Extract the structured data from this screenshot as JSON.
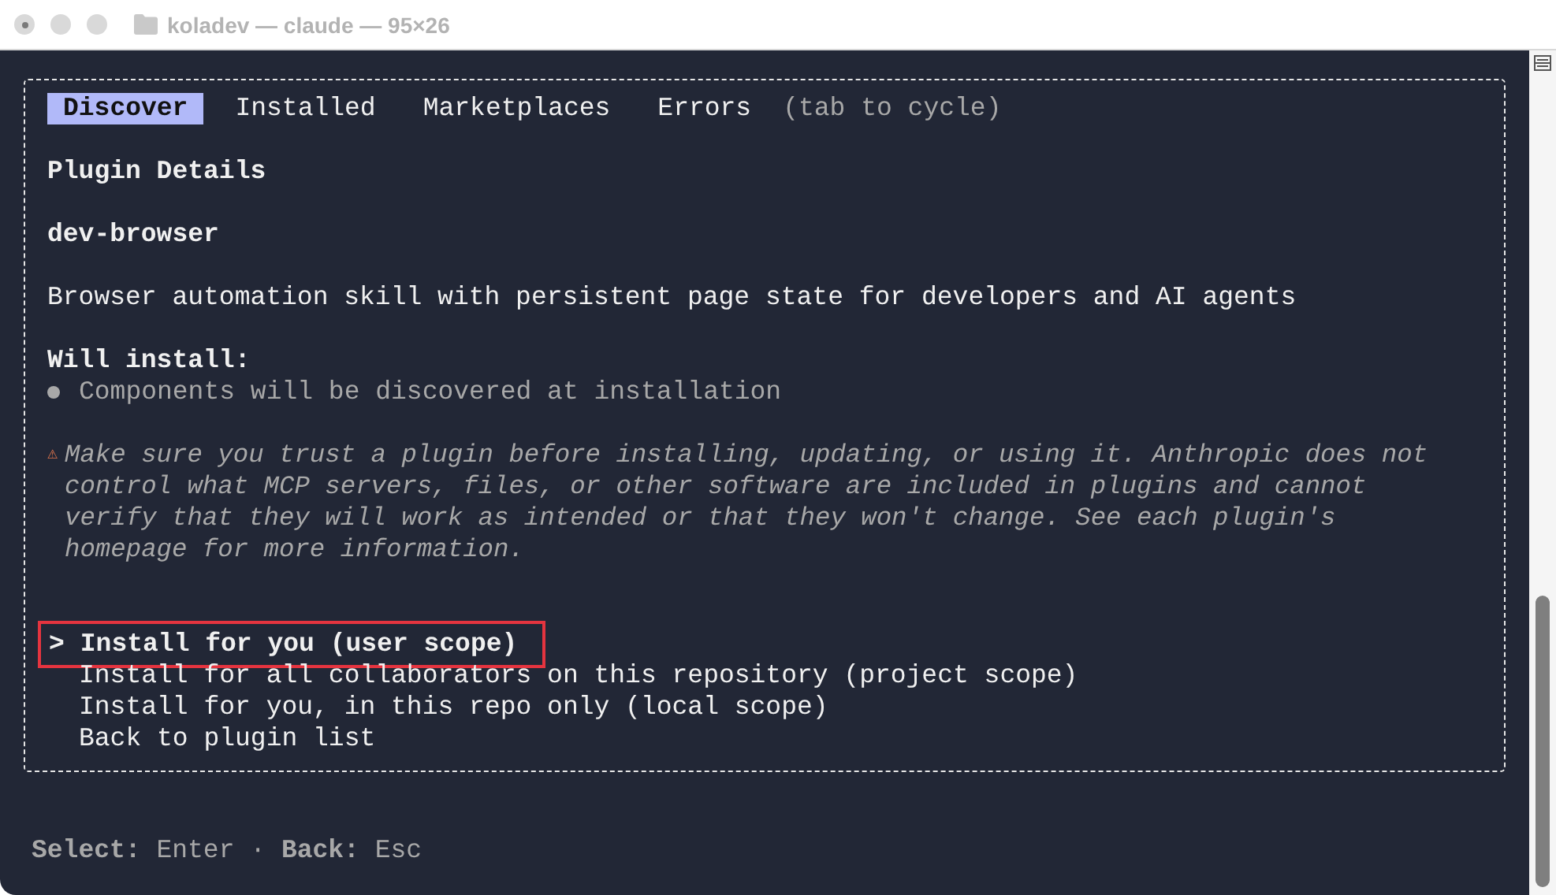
{
  "window": {
    "title": "koladev — claude — 95×26"
  },
  "tabs": [
    {
      "label": "Discover",
      "selected": true
    },
    {
      "label": "Installed",
      "selected": false
    },
    {
      "label": "Marketplaces",
      "selected": false
    },
    {
      "label": "Errors",
      "selected": false
    }
  ],
  "tab_hint": "(tab to cycle)",
  "heading": "Plugin Details",
  "plugin_name": "dev-browser",
  "description": "Browser automation skill with persistent page state for developers and AI agents",
  "will_install": {
    "label": "Will install:",
    "items": [
      "Components will be discovered at installation"
    ]
  },
  "warning": {
    "icon": "⚠",
    "lines": [
      "Make sure you trust a plugin before installing, updating, or using it. Anthropic does not",
      "control what MCP servers, files, or other software are included in plugins and cannot",
      "verify that they will work as intended or that they won't change. See each plugin's",
      "homepage for more information."
    ]
  },
  "options": {
    "cursor": ">",
    "items": [
      {
        "label": "Install for you (user scope)",
        "selected": true
      },
      {
        "label": "Install for all collaborators on this repository (project scope)",
        "selected": false
      },
      {
        "label": "Install for you, in this repo only (local scope)",
        "selected": false
      },
      {
        "label": "Back to plugin list",
        "selected": false
      }
    ]
  },
  "footer": "**Select:** Enter · **Back:** Esc"
}
